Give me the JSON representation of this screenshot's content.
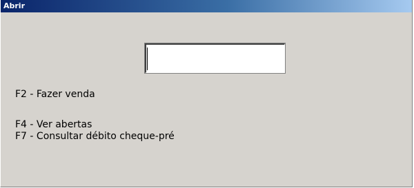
{
  "window": {
    "title": "Abrir"
  },
  "form": {
    "input_value": "",
    "input_placeholder": ""
  },
  "shortcuts": [
    {
      "label": "F2 - Fazer venda"
    },
    {
      "label": "F4 - Ver abertas"
    },
    {
      "label": "F7 - Consultar débito cheque-pré"
    }
  ],
  "colors": {
    "titlebar_start": "#0a246a",
    "titlebar_end": "#a6caf0",
    "window_background": "#d6d3ce",
    "input_background": "#ffffff"
  }
}
